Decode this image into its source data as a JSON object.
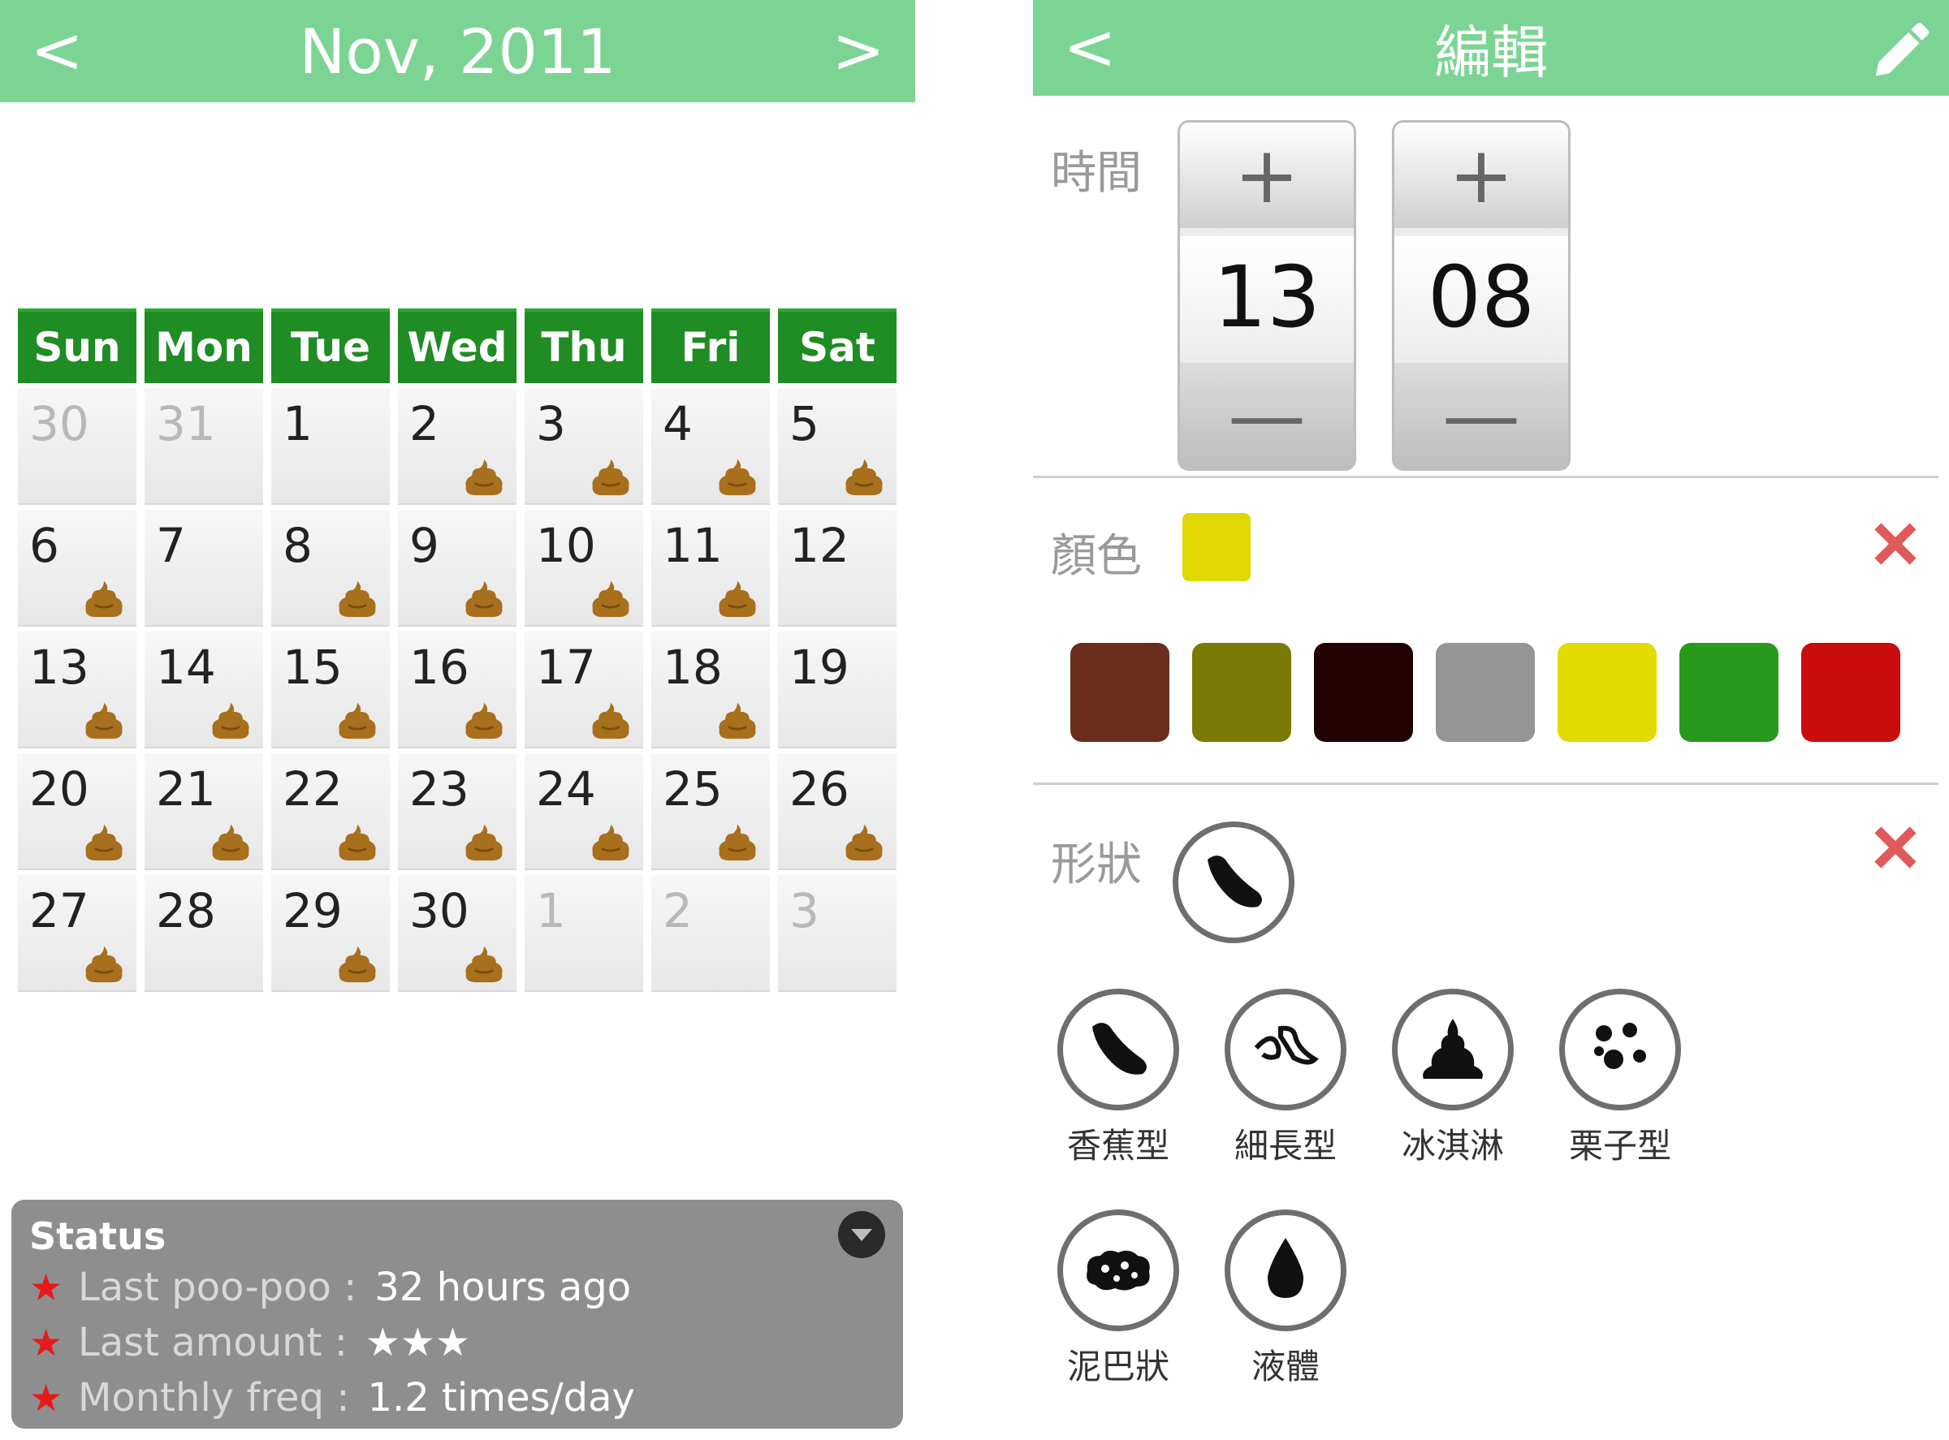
{
  "calendar_screen": {
    "header": {
      "prev": "<",
      "title": "Nov, 2011",
      "next": ">"
    },
    "weekdays": [
      "Sun",
      "Mon",
      "Tue",
      "Wed",
      "Thu",
      "Fri",
      "Sat"
    ],
    "weeks": [
      [
        {
          "d": "30",
          "other": true,
          "poo": false
        },
        {
          "d": "31",
          "other": true,
          "poo": false
        },
        {
          "d": "1",
          "other": false,
          "poo": false
        },
        {
          "d": "2",
          "other": false,
          "poo": true
        },
        {
          "d": "3",
          "other": false,
          "poo": true
        },
        {
          "d": "4",
          "other": false,
          "poo": true
        },
        {
          "d": "5",
          "other": false,
          "poo": true
        }
      ],
      [
        {
          "d": "6",
          "other": false,
          "poo": true
        },
        {
          "d": "7",
          "other": false,
          "poo": false
        },
        {
          "d": "8",
          "other": false,
          "poo": true
        },
        {
          "d": "9",
          "other": false,
          "poo": true
        },
        {
          "d": "10",
          "other": false,
          "poo": true
        },
        {
          "d": "11",
          "other": false,
          "poo": true
        },
        {
          "d": "12",
          "other": false,
          "poo": false
        }
      ],
      [
        {
          "d": "13",
          "other": false,
          "poo": true
        },
        {
          "d": "14",
          "other": false,
          "poo": true
        },
        {
          "d": "15",
          "other": false,
          "poo": true
        },
        {
          "d": "16",
          "other": false,
          "poo": true
        },
        {
          "d": "17",
          "other": false,
          "poo": true
        },
        {
          "d": "18",
          "other": false,
          "poo": true
        },
        {
          "d": "19",
          "other": false,
          "poo": false
        }
      ],
      [
        {
          "d": "20",
          "other": false,
          "poo": true
        },
        {
          "d": "21",
          "other": false,
          "poo": true
        },
        {
          "d": "22",
          "other": false,
          "poo": true
        },
        {
          "d": "23",
          "other": false,
          "poo": true
        },
        {
          "d": "24",
          "other": false,
          "poo": true
        },
        {
          "d": "25",
          "other": false,
          "poo": true
        },
        {
          "d": "26",
          "other": false,
          "poo": true
        }
      ],
      [
        {
          "d": "27",
          "other": false,
          "poo": true
        },
        {
          "d": "28",
          "other": false,
          "poo": false
        },
        {
          "d": "29",
          "other": false,
          "poo": true
        },
        {
          "d": "30",
          "other": false,
          "poo": true
        },
        {
          "d": "1",
          "other": true,
          "poo": false
        },
        {
          "d": "2",
          "other": true,
          "poo": false
        },
        {
          "d": "3",
          "other": true,
          "poo": false
        }
      ]
    ],
    "status": {
      "title": "Status",
      "star": "★",
      "lines": [
        {
          "label": "Last poo-poo :",
          "value": "32 hours ago"
        },
        {
          "label": "Last amount :",
          "value": "★★★"
        },
        {
          "label": "Monthly freq :",
          "value": "1.2 times/day"
        }
      ]
    }
  },
  "edit_screen": {
    "header": {
      "back": "<",
      "title": "編輯"
    },
    "time": {
      "label": "時間",
      "hour": "13",
      "minute": "08",
      "plus": "+",
      "minus": "—"
    },
    "color": {
      "label": "顏色",
      "selected": "#e0d800",
      "swatches": [
        "#6b2e1d",
        "#7a7a06",
        "#220202",
        "#959595",
        "#e2db00",
        "#279a1c",
        "#c90c0c"
      ]
    },
    "shape": {
      "label": "形狀",
      "options": [
        {
          "label": "香蕉型",
          "icon": "banana-icon"
        },
        {
          "label": "細長型",
          "icon": "thin-long-icon"
        },
        {
          "label": "冰淇淋",
          "icon": "ice-cream-icon"
        },
        {
          "label": "栗子型",
          "icon": "chestnut-icon"
        },
        {
          "label": "泥巴狀",
          "icon": "mud-icon"
        },
        {
          "label": "液體",
          "icon": "liquid-drop-icon"
        }
      ]
    }
  },
  "colors": {
    "header_green": "#7cd494",
    "weekday_green": "#1f8c24",
    "poo_brown": "#a86f1c",
    "delete_red": "#e05a5a"
  }
}
